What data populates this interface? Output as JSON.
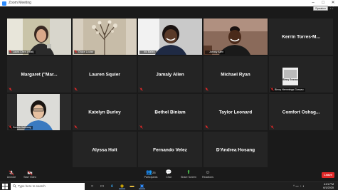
{
  "window": {
    "title": "Zoom Meeting",
    "speaker_view_label": "Speaker View"
  },
  "participants": [
    {
      "name": "Laura Chen (Host)",
      "video": true,
      "muted": true,
      "active": true
    },
    {
      "name": "Grace Louise",
      "video": true,
      "muted": true
    },
    {
      "name": "Iris Bailey",
      "video": true,
      "muted": false
    },
    {
      "name": "Jamaly Allen",
      "video": true,
      "muted": false
    },
    {
      "name": "Kerrin Torres-M...",
      "video": false,
      "muted": false
    },
    {
      "name": "Margaret (\"Mar...",
      "video": false,
      "muted": true
    },
    {
      "name": "Lauren Squier",
      "video": false,
      "muted": true
    },
    {
      "name": "Jamaly Allen",
      "video": false,
      "muted": true
    },
    {
      "name": "Michael Ryan",
      "video": false,
      "muted": true
    },
    {
      "name": "Binny Hemmings Gossau",
      "video": true,
      "muted": true
    },
    {
      "name": "Donna Hathway",
      "video": true,
      "muted": true
    },
    {
      "name": "Katelyn Burley",
      "video": false,
      "muted": true
    },
    {
      "name": "Bethel Biniam",
      "video": false,
      "muted": true
    },
    {
      "name": "Taylor Leonard",
      "video": false,
      "muted": true
    },
    {
      "name": "Comfort Oshag...",
      "video": false,
      "muted": true
    },
    {
      "name": "Alyssa Holt",
      "video": false,
      "muted": false
    },
    {
      "name": "Fernando Velez",
      "video": false,
      "muted": false
    },
    {
      "name": "D'Andrea Hosang",
      "video": false,
      "muted": false
    }
  ],
  "book_cover_text": "Binny Gossau",
  "toolbar": {
    "unmute": "Unmute",
    "start_video": "Start Video",
    "participants": "Participants",
    "participants_count": "25",
    "chat": "Chat",
    "share_screen": "Share Screen",
    "reactions": "Reactions",
    "leave": "Leave"
  },
  "taskbar": {
    "search_placeholder": "Type here to search",
    "time": "4:21 PM",
    "date": "6/1/2020"
  },
  "colors": {
    "active_speaker": "#8cd43a",
    "leave": "#e02828",
    "share": "#4cc44c"
  }
}
